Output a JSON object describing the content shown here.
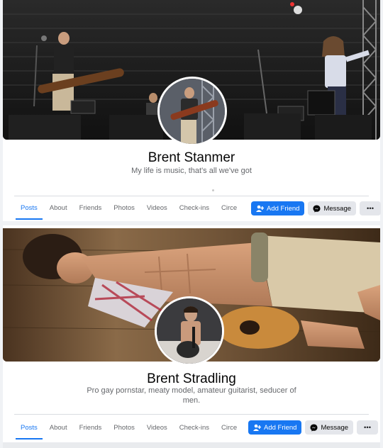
{
  "profiles": [
    {
      "name": "Brent Stanmer",
      "bio": "My life is music, that's all we've got",
      "tabs": [
        "Posts",
        "About",
        "Friends",
        "Photos",
        "Videos",
        "Check-ins",
        "Circe"
      ],
      "buttons": {
        "add_friend": "Add Friend",
        "message": "Message",
        "more": "•••"
      }
    },
    {
      "name": "Brent Stradling",
      "bio": "Pro gay pornstar, meaty model, amateur guitarist, seducer of men.",
      "tabs": [
        "Posts",
        "About",
        "Friends",
        "Photos",
        "Videos",
        "Check-ins",
        "Circe"
      ],
      "buttons": {
        "add_friend": "Add Friend",
        "message": "Message",
        "more": "•••"
      }
    }
  ],
  "colors": {
    "accent": "#1877f2",
    "muted_text": "#65676b",
    "background": "#f0f2f5"
  },
  "icons": {
    "add_friend": "person-plus-icon",
    "message": "messenger-icon"
  }
}
